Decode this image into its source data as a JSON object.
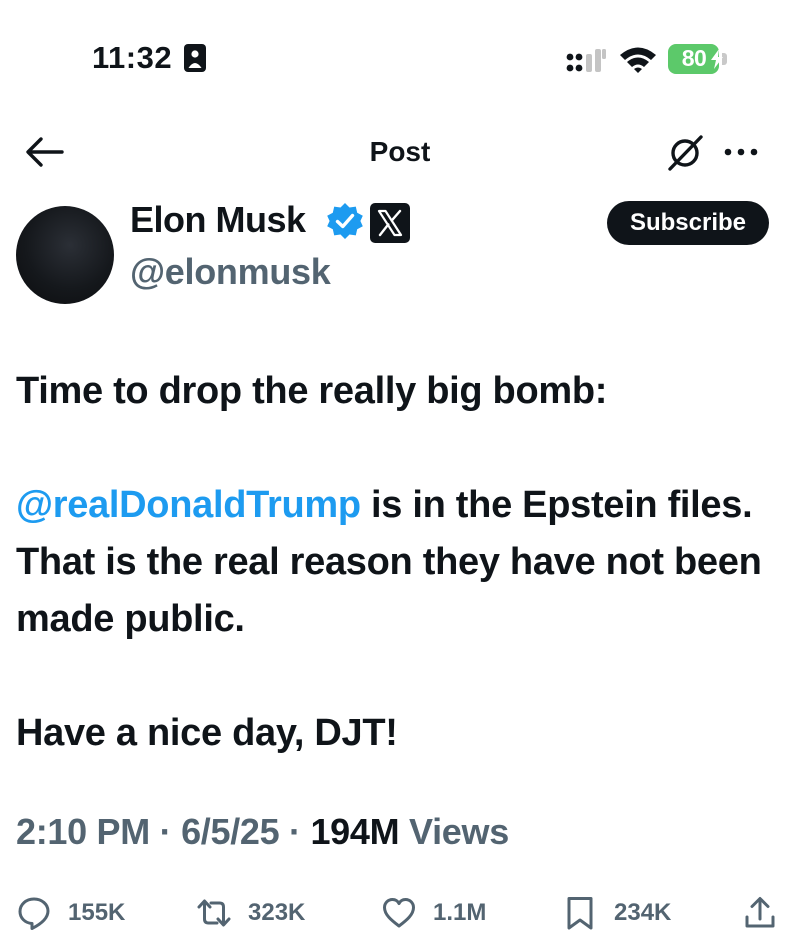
{
  "status_bar": {
    "time": "11:32",
    "battery": "80"
  },
  "header": {
    "title": "Post"
  },
  "author": {
    "name": "Elon Musk",
    "handle": "@elonmusk",
    "subscribe_label": "Subscribe"
  },
  "post": {
    "line1": "Time to drop the really big bomb:",
    "mention": "@realDonaldTrump",
    "line2_rest": " is in the Epstein files. That is the real reason they have not been made public.",
    "line3": "Have a nice day, DJT!"
  },
  "meta": {
    "time": "2:10 PM",
    "separator": " · ",
    "date": "6/5/25",
    "views_count": "194M",
    "views_label": " Views"
  },
  "actions": {
    "replies": "155K",
    "reposts": "323K",
    "likes": "1.1M",
    "bookmarks": "234K"
  },
  "colors": {
    "accent": "#1d9bf0",
    "secondary_text": "#536471",
    "battery": "#5cc96a"
  },
  "icons": [
    "record-icon",
    "signal-icon",
    "wifi-icon",
    "bolt-icon",
    "back-arrow-icon",
    "grok-icon",
    "more-icon",
    "verified-icon",
    "x-badge-icon",
    "reply-icon",
    "repost-icon",
    "like-icon",
    "bookmark-icon",
    "share-icon"
  ]
}
